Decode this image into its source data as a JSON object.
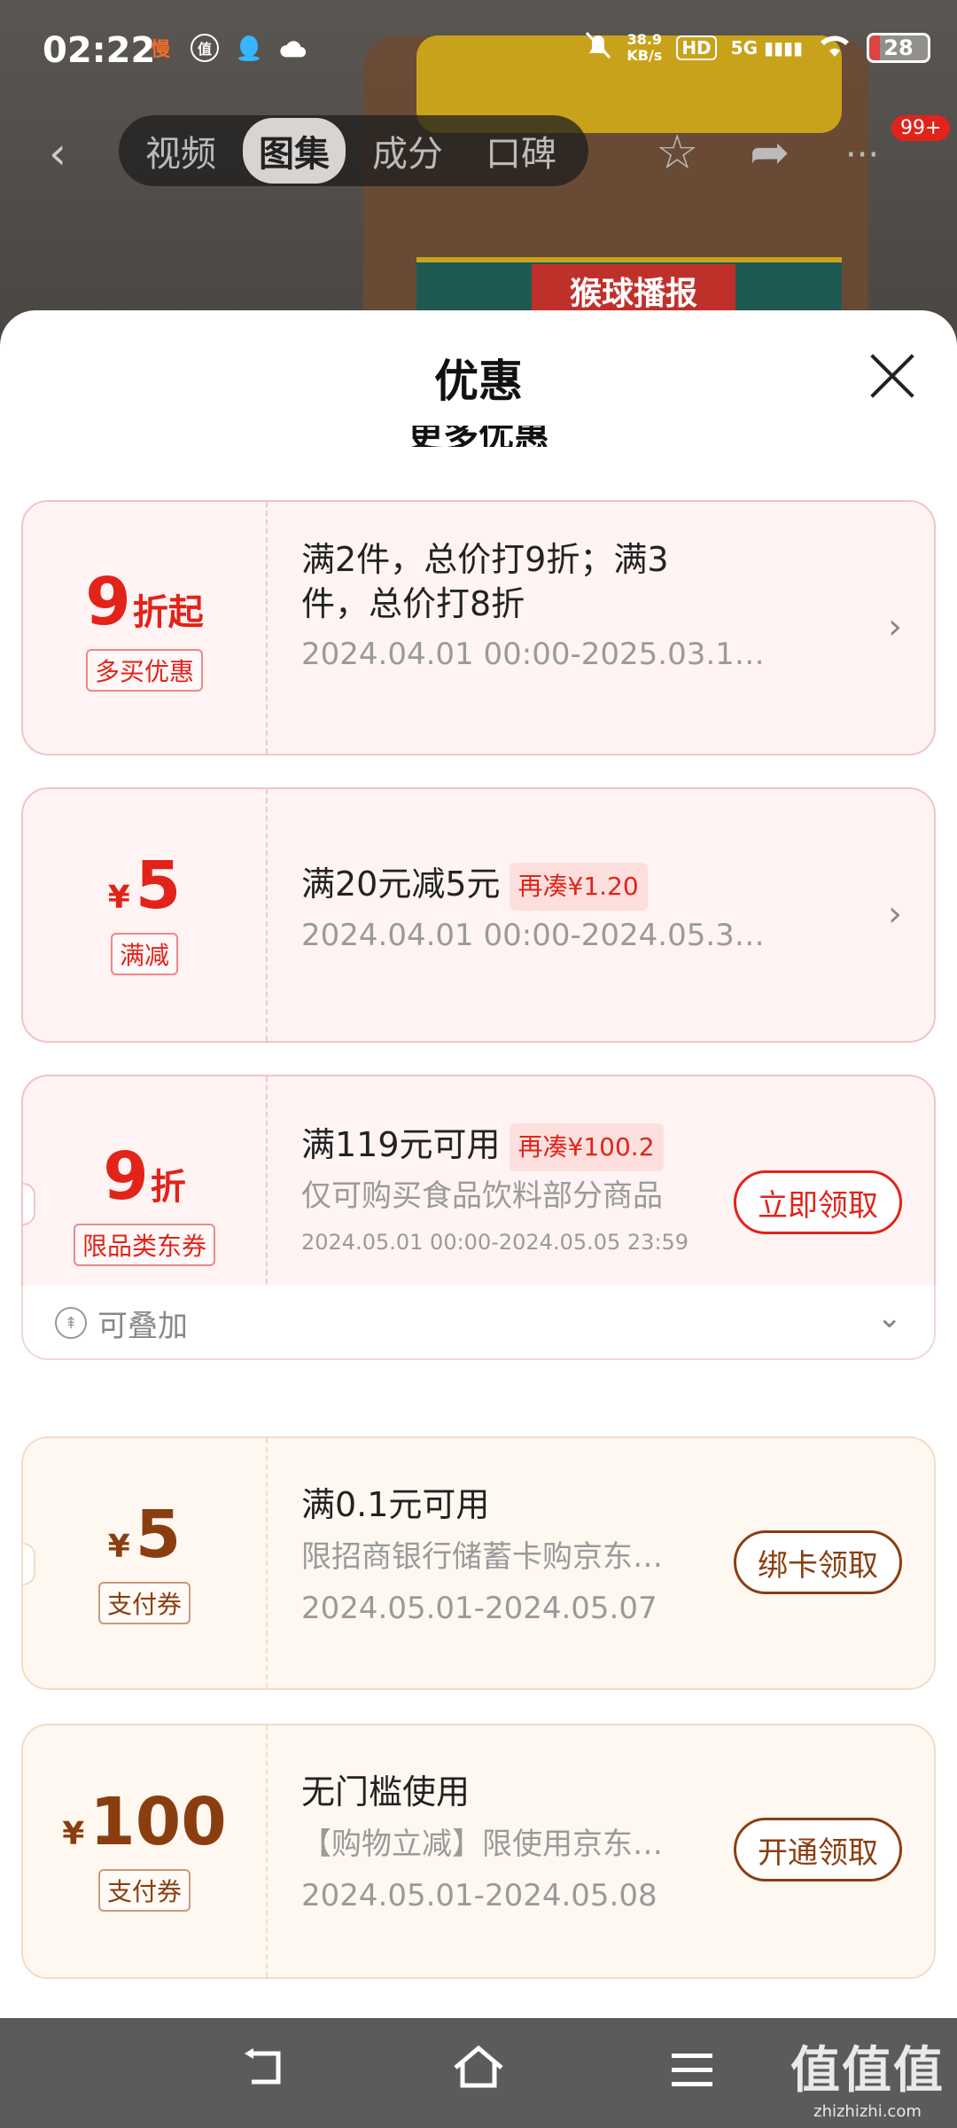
{
  "status": {
    "time": "02:22",
    "left_icons": [
      "慢",
      "值",
      "qq-icon",
      "cloud-icon"
    ],
    "net_speed": "38.9",
    "net_unit": "KB/s",
    "hd": "HD",
    "signal": "5G",
    "battery": "28"
  },
  "nav": {
    "tabs": [
      "视频",
      "图集",
      "成分",
      "口碑"
    ],
    "active_tab": "图集",
    "badge": "99+",
    "product_banner": "猴球播报"
  },
  "sheet": {
    "title": "优惠",
    "section_header": "更多优惠"
  },
  "promos": [
    {
      "value": "9",
      "suffix": "折起",
      "tag": "多买优惠",
      "title": "满2件，总价打9折；满3件，总价打8折",
      "period": "2024.04.01 00:00-2025.03.1…"
    },
    {
      "currency": "¥",
      "value": "5",
      "tag": "满减",
      "title": "满20元减5元",
      "pill": "再凑¥1.20",
      "period": "2024.04.01 00:00-2024.05.3…"
    },
    {
      "value": "9",
      "suffix": "折",
      "tag": "限品类东券",
      "title": "满119元可用",
      "pill": "再凑¥100.2",
      "desc": "仅可购买食品饮料部分商品",
      "period": "2024.05.01 00:00-2024.05.05 23:59",
      "button": "立即领取",
      "stack_label": "可叠加"
    },
    {
      "currency": "¥",
      "value": "5",
      "tag": "支付券",
      "title": "满0.1元可用",
      "desc": "限招商银行储蓄卡购京东…",
      "period": "2024.05.01-2024.05.07",
      "button": "绑卡领取"
    },
    {
      "currency": "¥",
      "value": "100",
      "tag": "支付券",
      "title": "无门槛使用",
      "desc": "【购物立减】限使用京东…",
      "period": "2024.05.01-2024.05.08",
      "button": "开通领取"
    }
  ],
  "watermark": {
    "main": "值值值",
    "sub": "zhizhizhi.com"
  },
  "colors": {
    "accent_red": "#e2231a",
    "accent_brown": "#8a3e10"
  }
}
